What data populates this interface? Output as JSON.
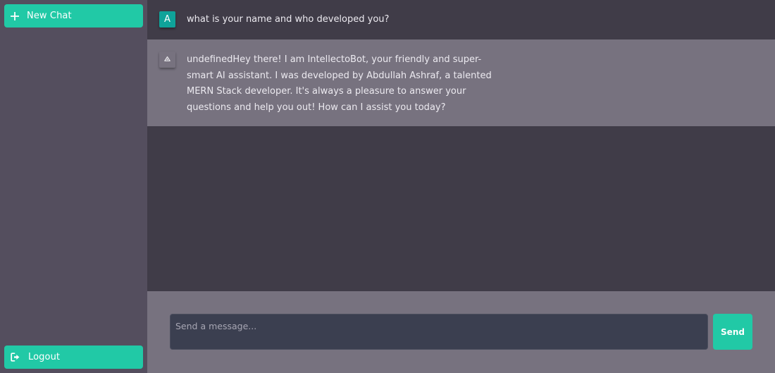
{
  "sidebar": {
    "new_chat": {
      "label": "New Chat",
      "icon": "plus-icon"
    },
    "logout": {
      "label": "Logout",
      "icon": "sign-out-icon"
    }
  },
  "conversation": {
    "messages": [
      {
        "role": "user",
        "avatar_letter": "A",
        "text": "what is your name and who developed you?"
      },
      {
        "role": "bot",
        "avatar_icon": "bot-icon",
        "text": "undefinedHey there! I am IntellectoBot, your friendly and super-smart AI assistant. I was developed by Abdullah Ashraf, a talented MERN Stack developer. It's always a pleasure to answer your questions and help you out! How can I assist you today?"
      }
    ]
  },
  "composer": {
    "placeholder": "Send a message...",
    "value": "",
    "send_label": "Send"
  },
  "colors": {
    "accent": "#21c9a6",
    "sidebar_bg": "#544e5e",
    "main_bg": "#403c48",
    "bot_row_bg": "#77727f",
    "input_bg": "#3b3f50",
    "user_avatar_bg": "#0fa39a"
  }
}
